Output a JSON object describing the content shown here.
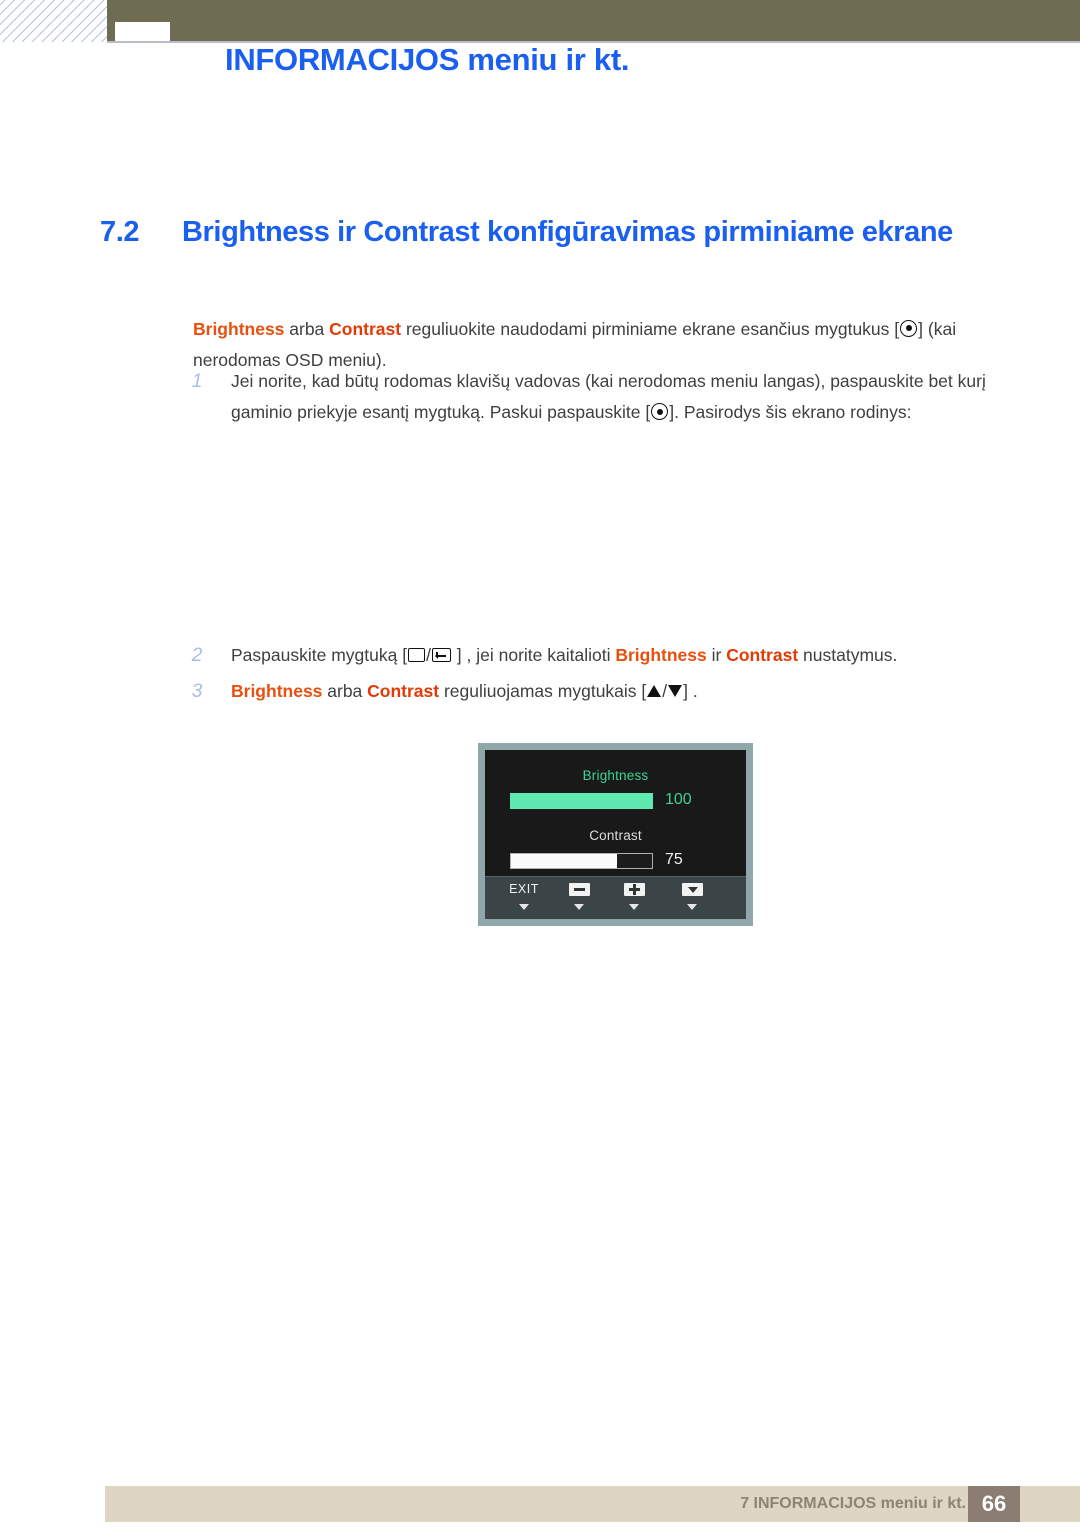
{
  "header": {
    "title": "INFORMACIJOS meniu ir kt."
  },
  "section": {
    "number": "7.2",
    "title": "Brightness ir Contrast konfigūravimas pirminiame ekrane"
  },
  "intro": {
    "term_brightness": "Brightness",
    "word_arba": " arba ",
    "term_contrast": "Contrast",
    "text_after": " reguliuokite naudodami pirminiame ekrane esančius mygtukus [",
    "text_tail": "] (kai nerodomas OSD meniu)."
  },
  "steps": [
    {
      "number": "1",
      "text_part1": "Jei norite, kad būtų rodomas klavišų vadovas (kai nerodomas meniu langas), paspauskite bet kurį gaminio priekyje esantį mygtuką. Paskui paspauskite [",
      "text_part2": "]. Pasirodys šis ekrano rodinys:"
    },
    {
      "number": "2",
      "text_part1": "Paspauskite mygtuką [",
      "separator": "/",
      "text_part2": " ] , jei norite kaitalioti ",
      "term_brightness": "Brightness",
      "word_ir": " ir ",
      "term_contrast": "Contrast",
      "text_part3": " nustatymus."
    },
    {
      "number": "3",
      "term_brightness": "Brightness",
      "word_arba": " arba ",
      "term_contrast": "Contrast",
      "text_part1": " reguliuojamas mygtukais [",
      "separator": "/",
      "text_part2": "] ."
    }
  ],
  "osd": {
    "brightness_label": "Brightness",
    "brightness_value": "100",
    "brightness_percent": 100,
    "contrast_label": "Contrast",
    "contrast_value": "75",
    "contrast_percent": 75,
    "buttons": [
      {
        "label": "EXIT",
        "icon": "exit-text"
      },
      {
        "label": "",
        "icon": "minus-icon"
      },
      {
        "label": "",
        "icon": "plus-icon"
      },
      {
        "label": "",
        "icon": "down-arrow-icon"
      }
    ],
    "colors": {
      "frame": "#8fa7aa",
      "panel": "#191919",
      "brightness_fill": "#5fe8af",
      "contrast_fill": "#fbfbfb",
      "footer_bar": "#3b4446"
    }
  },
  "footer": {
    "text": "7 INFORMACIJOS meniu ir kt.",
    "page_number": "66"
  },
  "colors": {
    "heading_blue": "#1a5ff0",
    "term_orange": "#e8500f",
    "olive_bar": "#6f6c54",
    "footer_beige": "#ded6c2",
    "footer_page_brown": "#8b7d72",
    "step_number_blue": "#a8bce8"
  }
}
